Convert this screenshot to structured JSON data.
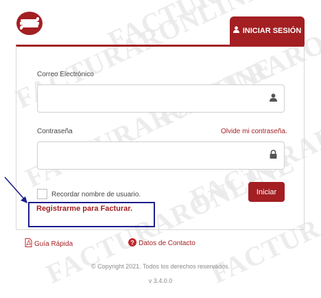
{
  "watermark": {
    "text": "FACTURARONLINE"
  },
  "brand": {
    "logo_icon": "facturar-online-logo",
    "accent_color": "#a31f22"
  },
  "tab": {
    "label": "INICIAR SESIÓN",
    "icon": "user-icon"
  },
  "email": {
    "label": "Correo Electrónico",
    "value": "",
    "icon": "user-icon"
  },
  "password": {
    "label": "Contraseña",
    "value": "",
    "icon": "lock-icon",
    "forgot_label": "Olvide mi contraseña."
  },
  "remember": {
    "label": "Recordar nombre de usuario.",
    "checked": false
  },
  "login_button": {
    "label": "Iniciar"
  },
  "register": {
    "label": "Registrarme para Facturar.",
    "highlight_color": "#1c1c8e"
  },
  "footer_links": {
    "quick_guide": {
      "label": "Guía Rápida",
      "icon": "pdf-icon"
    },
    "contact": {
      "label": "Datos de Contacto",
      "icon": "help-icon"
    }
  },
  "copyright": "© Copyright 2021. Todos los derechos reservados.",
  "version": "v 3.4.0.0"
}
